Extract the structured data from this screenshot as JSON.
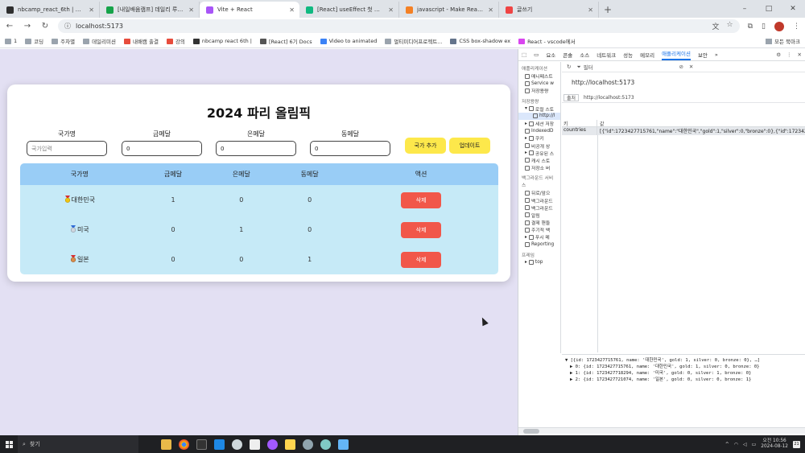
{
  "browser": {
    "tabs": [
      {
        "title": "nbcamp_react_6th | 일고",
        "color": "#2f2f2f",
        "active": false
      },
      {
        "title": "[내일배움캠프] 데일리 루틴(6s",
        "color": "#16a34a",
        "active": false
      },
      {
        "title": "Vite + React",
        "color": "#a855f7",
        "active": true
      },
      {
        "title": "[React] useEffect 첫 렌더링 시",
        "color": "#10b981",
        "active": false
      },
      {
        "title": "javascript - Make React useEff",
        "color": "#f48024",
        "active": false
      },
      {
        "title": "글쓰기",
        "color": "#ef4444",
        "active": false
      }
    ],
    "new_tab": "+",
    "window_controls": [
      "–",
      "□",
      "✕"
    ],
    "address": "localhost:5173",
    "bookmarks": [
      "1",
      "코딩",
      "주차별",
      "데일리미션",
      "내배캠 출결",
      "강의",
      "nbcamp react 6th |",
      "[React] 6기 Docs",
      "Video to animated",
      "멀티미디어프로젝트...",
      "CSS box-shadow ex",
      "React - vscode에서"
    ],
    "bookmarks_right": "모든 북마크"
  },
  "app": {
    "title": "2024 파리 올림픽",
    "form": {
      "country_label": "국가명",
      "country_placeholder": "국가입력",
      "gold_label": "금메달",
      "gold_value": "0",
      "silver_label": "은메달",
      "silver_value": "0",
      "bronze_label": "동메달",
      "bronze_value": "0",
      "add_button": "국가 추가",
      "update_button": "업데이트"
    },
    "table": {
      "headers": [
        "국가명",
        "금메달",
        "은메달",
        "동메달",
        "액션"
      ],
      "rows": [
        {
          "country": "대한민국",
          "gold": "1",
          "silver": "0",
          "bronze": "0",
          "action": "삭제"
        },
        {
          "country": "미국",
          "gold": "0",
          "silver": "1",
          "bronze": "0",
          "action": "삭제"
        },
        {
          "country": "일본",
          "gold": "0",
          "silver": "0",
          "bronze": "1",
          "action": "삭제"
        }
      ]
    }
  },
  "devtools": {
    "tabs": [
      "요소",
      "콘솔",
      "소스",
      "네트워크",
      "성능",
      "메모리",
      "애플리케이션",
      "보안"
    ],
    "active_tab": "애플리케이션",
    "sidebar": {
      "section_app": "애플리케이션",
      "app_items": [
        "매니페스트",
        "Service w",
        "저장용량"
      ],
      "section_storage": "저장용량",
      "storage_items": [
        "로컬 스토",
        "http://l",
        "세션 저장",
        "IndexedD",
        "쿠키",
        "비공개 상",
        "공유된 스",
        "캐시 스토",
        "저장소 버"
      ],
      "section_background": "백그라운드 서비스",
      "background_items": [
        "뒤로/앞으",
        "백그라운드",
        "백그라운드",
        "알림",
        "결제 핸들",
        "주기적 백",
        "푸시 메",
        "Reporting"
      ],
      "section_frames": "프레임",
      "frames_items": [
        "top"
      ]
    },
    "filter_placeholder": "필터",
    "origin_url": "http://localhost:5173",
    "origin_label": "출처",
    "origin_value": "http://localhost:5173",
    "table": {
      "key_header": "키",
      "value_header": "값",
      "rows": [
        {
          "key": "countries",
          "value": "[{\"id\":1723427715761,\"name\":\"대한민국\",\"gold\":1,\"silver\":0,\"bronze\":0},{\"id\":1723427"
        }
      ]
    },
    "preview": [
      "▼ [{id: 1723427715761, name: '대한민국', gold: 1, silver: 0, bronze: 0}, …]",
      "▶ 0: {id: 1723427715761, name: '대한민국', gold: 1, silver: 0, bronze: 0}",
      "▶ 1: {id: 1723427718294, name: '미국', gold: 0, silver: 1, bronze: 0}",
      "▶ 2: {id: 1723427721074, name: '일본', gold: 0, silver: 0, bronze: 1}"
    ]
  },
  "taskbar": {
    "search_label": "찾기",
    "clock_time": "오전 10:56",
    "clock_date": "2024-08-12",
    "notifications": "21"
  }
}
